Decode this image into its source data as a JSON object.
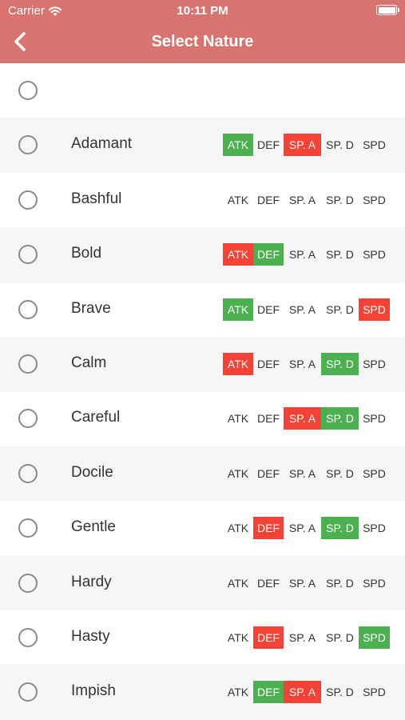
{
  "status_bar": {
    "carrier": "Carrier",
    "time": "10:11 PM"
  },
  "header": {
    "title": "Select Nature",
    "back_icon": "chevron-left-icon"
  },
  "colors": {
    "header_bg": "#d87370",
    "increase": "#4caf50",
    "decrease": "#f44336"
  },
  "stat_labels": [
    "ATK",
    "DEF",
    "SP. A",
    "SP. D",
    "SPD"
  ],
  "natures": [
    {
      "name": "",
      "up": null,
      "down": null
    },
    {
      "name": "Adamant",
      "up": "ATK",
      "down": "SP. A"
    },
    {
      "name": "Bashful",
      "up": null,
      "down": null
    },
    {
      "name": "Bold",
      "up": "DEF",
      "down": "ATK"
    },
    {
      "name": "Brave",
      "up": "ATK",
      "down": "SPD"
    },
    {
      "name": "Calm",
      "up": "SP. D",
      "down": "ATK"
    },
    {
      "name": "Careful",
      "up": "SP. D",
      "down": "SP. A"
    },
    {
      "name": "Docile",
      "up": null,
      "down": null
    },
    {
      "name": "Gentle",
      "up": "SP. D",
      "down": "DEF"
    },
    {
      "name": "Hardy",
      "up": null,
      "down": null
    },
    {
      "name": "Hasty",
      "up": "SPD",
      "down": "DEF"
    },
    {
      "name": "Impish",
      "up": "DEF",
      "down": "SP. A"
    }
  ]
}
